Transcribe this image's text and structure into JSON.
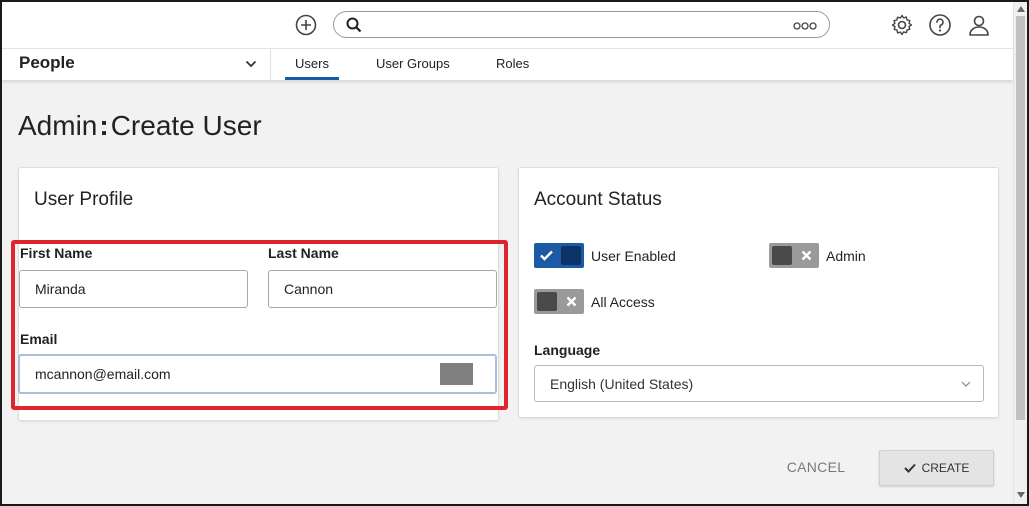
{
  "header": {
    "search": {
      "value": "",
      "placeholder": ""
    },
    "icons": [
      "add-circle-icon",
      "search-icon",
      "more-icon",
      "gear-icon",
      "help-icon",
      "user-icon"
    ]
  },
  "nav": {
    "module_label": "People",
    "tabs": [
      {
        "label": "Users",
        "active": true
      },
      {
        "label": "User Groups",
        "active": false
      },
      {
        "label": "Roles",
        "active": false
      }
    ]
  },
  "page": {
    "title_prefix": "Admin",
    "title_separator": ":",
    "title_main": "Create User"
  },
  "user_profile": {
    "title": "User Profile",
    "first_name_label": "First Name",
    "first_name_value": "Miranda",
    "last_name_label": "Last Name",
    "last_name_value": "Cannon",
    "email_label": "Email",
    "email_value": "mcannon@email.com"
  },
  "account_status": {
    "title": "Account Status",
    "toggles": [
      {
        "label": "User Enabled",
        "on": true
      },
      {
        "label": "Admin",
        "on": false
      },
      {
        "label": "All Access",
        "on": false
      }
    ],
    "language_label": "Language",
    "language_value": "English (United States)"
  },
  "actions": {
    "cancel_label": "CANCEL",
    "create_label": "CREATE"
  },
  "colors": {
    "accent": "#1c5aa6",
    "toggle_on_knob": "#0d3366",
    "highlight": "#e0242b"
  }
}
